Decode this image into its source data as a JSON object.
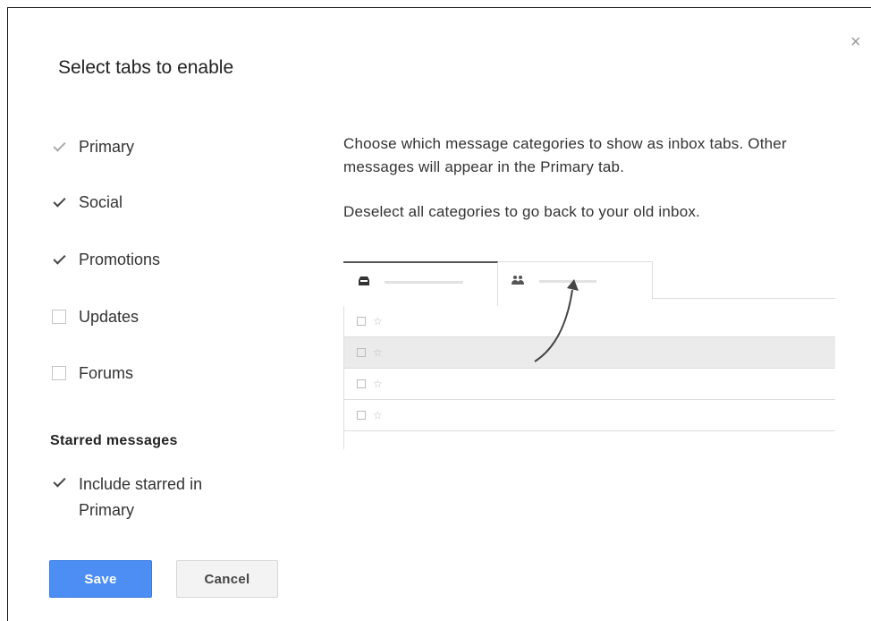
{
  "dialog": {
    "title": "Select tabs to enable",
    "close_glyph": "×",
    "options": [
      {
        "label": "Primary",
        "checked": true,
        "disabled": true
      },
      {
        "label": "Social",
        "checked": true,
        "disabled": false
      },
      {
        "label": "Promotions",
        "checked": true,
        "disabled": false
      },
      {
        "label": "Updates",
        "checked": false,
        "disabled": false
      },
      {
        "label": "Forums",
        "checked": false,
        "disabled": false
      }
    ],
    "starred_section_title": "Starred messages",
    "starred_option": {
      "label": "Include starred in Primary",
      "checked": true
    },
    "description": {
      "para1": "Choose which message categories to show as inbox tabs. Other messages will appear in the Primary tab.",
      "para2": "Deselect all categories to go back to your old inbox."
    },
    "preview": {
      "tab_icons": [
        "inbox-icon",
        "people-icon"
      ],
      "row_icons": [
        "checkbox-mini-icon",
        "star-icon"
      ],
      "star_glyph": "☆"
    },
    "buttons": {
      "save": "Save",
      "cancel": "Cancel"
    },
    "colors": {
      "save_bg": "#4c8ef3",
      "cancel_bg": "#f3f3f3"
    }
  }
}
